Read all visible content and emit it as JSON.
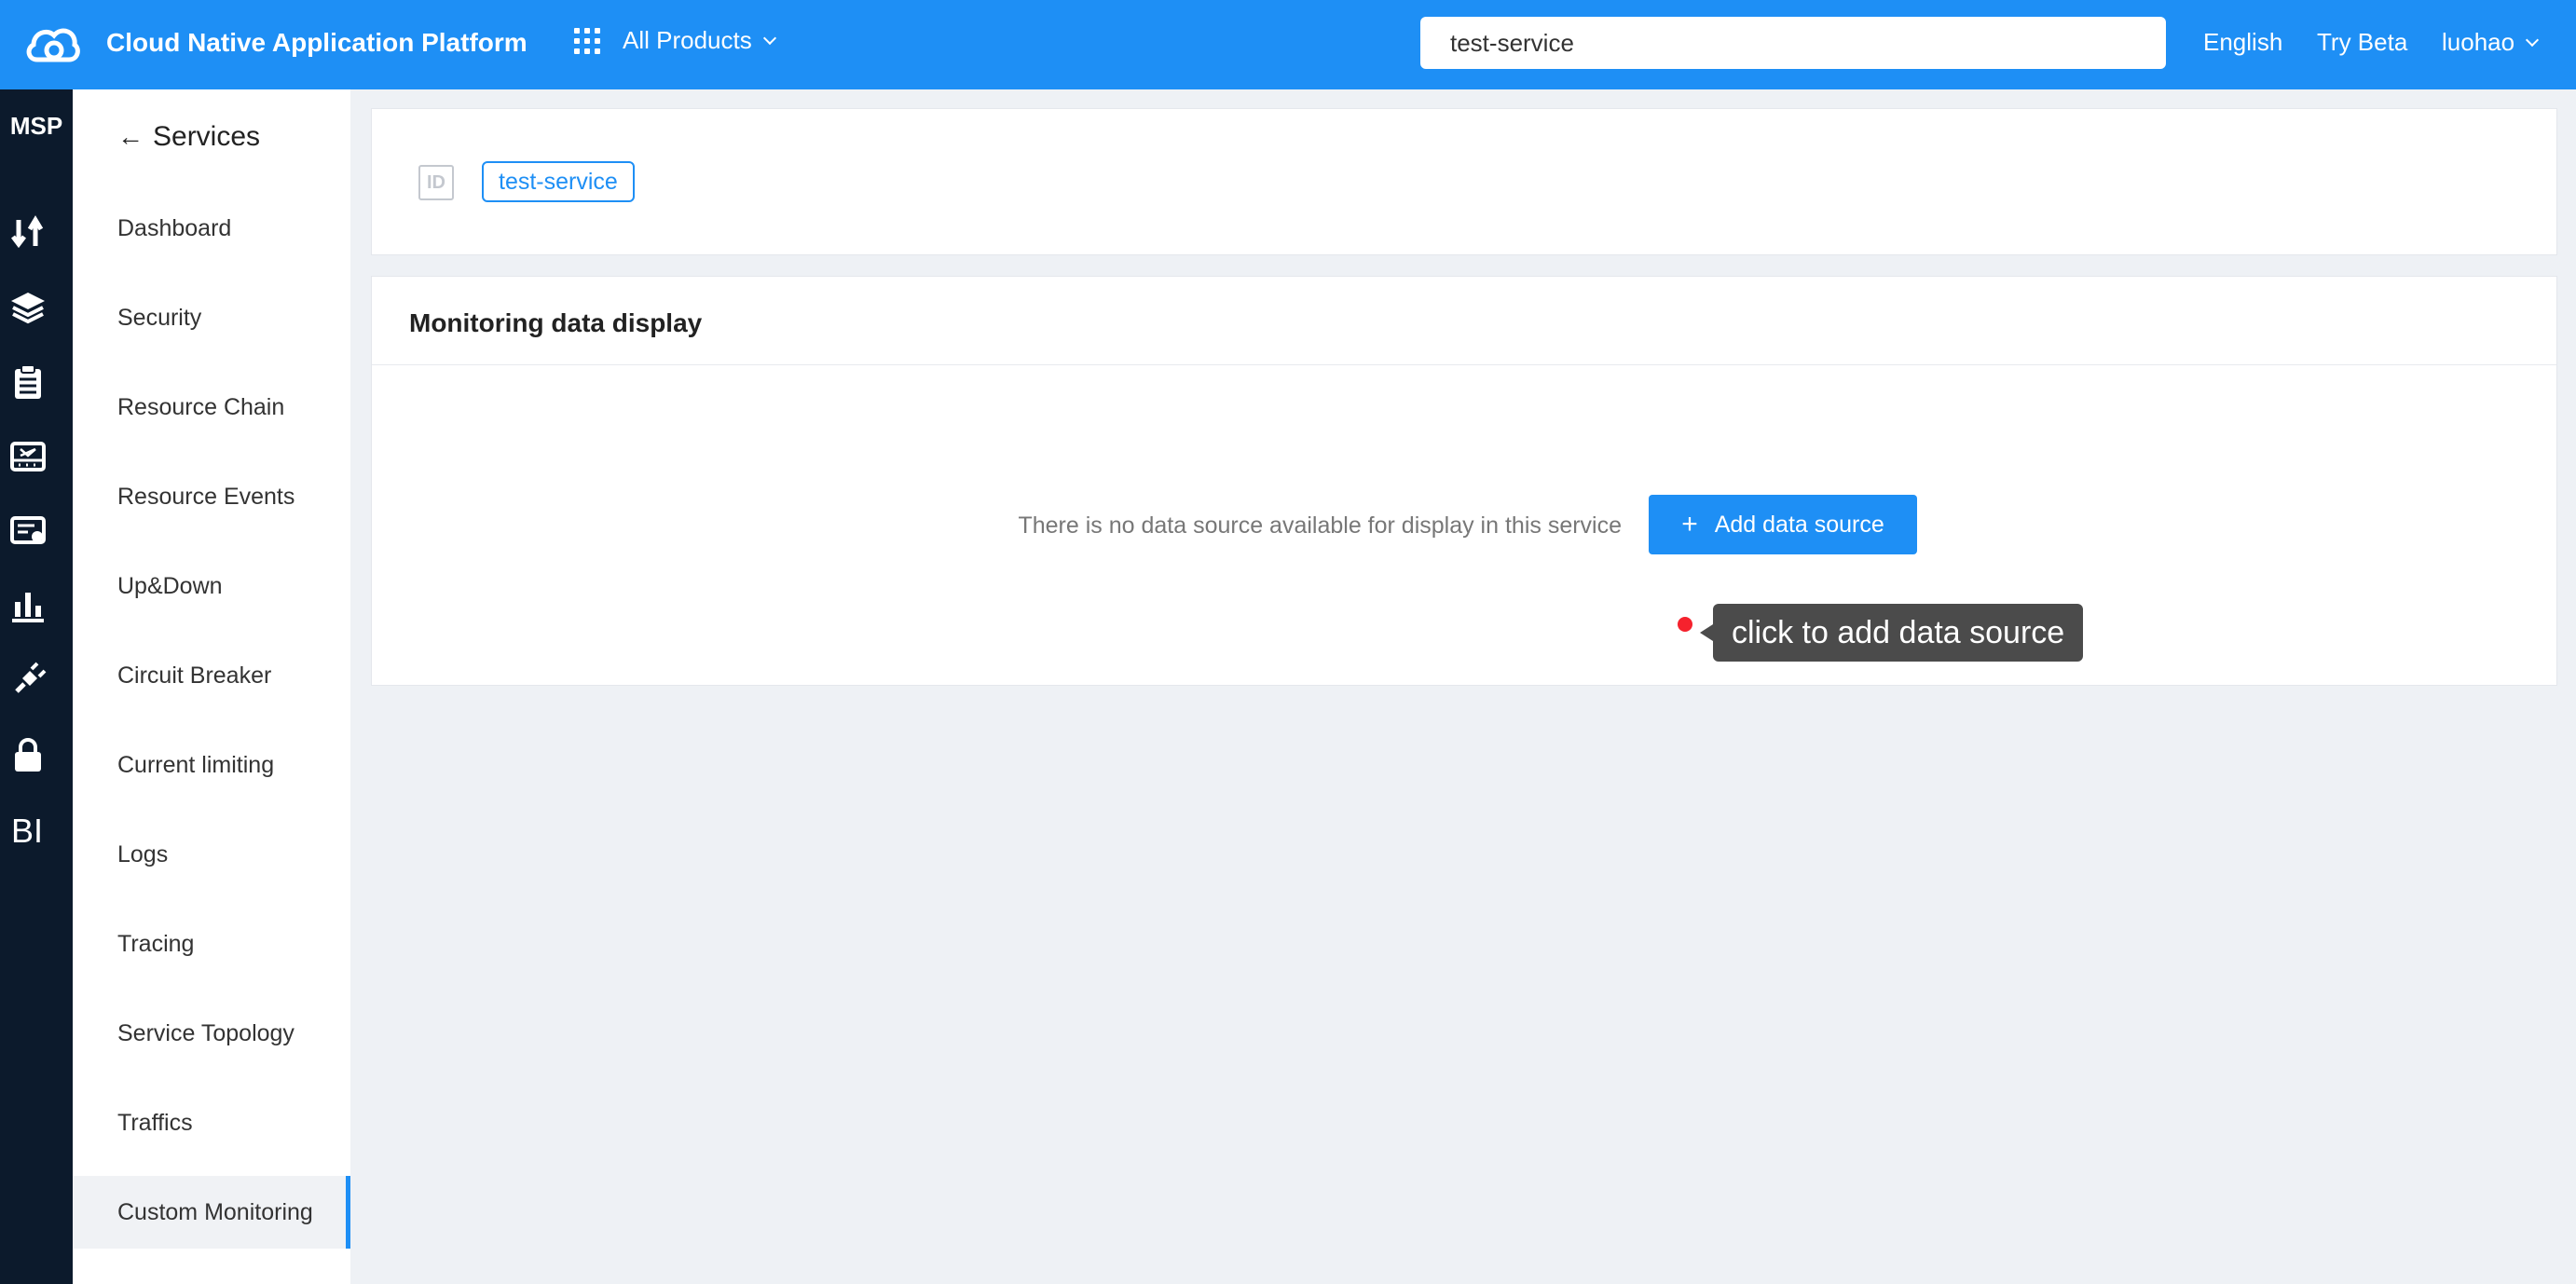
{
  "header": {
    "title": "Cloud Native Application Platform",
    "products_label": "All Products",
    "search_value": "test-service",
    "language": "English",
    "try_beta": "Try Beta",
    "user": "luohao"
  },
  "rail": {
    "label": "MSP",
    "icons": [
      "transfer-arrows-icon",
      "layers-icon",
      "clipboard-icon",
      "network-icon",
      "certificate-icon",
      "bar-chart-icon",
      "plug-icon",
      "lock-icon",
      "bi-icon"
    ]
  },
  "sidebar": {
    "back_label": "Services",
    "items": [
      {
        "label": "Dashboard"
      },
      {
        "label": "Security"
      },
      {
        "label": "Resource Chain"
      },
      {
        "label": "Resource Events"
      },
      {
        "label": "Up&Down"
      },
      {
        "label": "Circuit Breaker"
      },
      {
        "label": "Current limiting"
      },
      {
        "label": "Logs"
      },
      {
        "label": "Tracing"
      },
      {
        "label": "Service Topology"
      },
      {
        "label": "Traffics"
      },
      {
        "label": "Custom Monitoring"
      }
    ],
    "active_index": 11
  },
  "service_card": {
    "id_label": "ID",
    "service_tag": "test-service"
  },
  "monitoring": {
    "title": "Monitoring data display",
    "empty_text": "There is no data source available for display in this service",
    "add_button": "Add data source",
    "add_button_icon": "+"
  },
  "tooltip": {
    "text": "click to add data source"
  },
  "colors": {
    "primary": "#1e8ff5",
    "rail_bg": "#0c1a2c",
    "page_bg": "#eef1f5",
    "marker": "#f5222d"
  }
}
